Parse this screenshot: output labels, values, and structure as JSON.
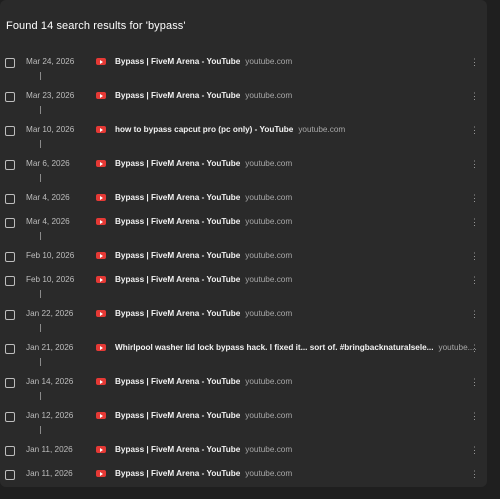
{
  "header": {
    "text": "Found 14 search results for 'bypass'"
  },
  "icons": {
    "favicon": "youtube-icon",
    "menu": "more-vert-icon"
  },
  "colors": {
    "background": "#1f1f1f",
    "panel": "#2a2a2a",
    "youtube_red": "#e53935"
  },
  "menu_glyph": "⋮",
  "results": [
    {
      "date": "Mar 24, 2026",
      "title": "Bypass | FiveM Arena - YouTube",
      "domain": "youtube.com"
    },
    {
      "date": "Mar 23, 2026",
      "title": "Bypass | FiveM Arena - YouTube",
      "domain": "youtube.com"
    },
    {
      "date": "Mar 10, 2026",
      "title": "how to bypass capcut pro (pc only) - YouTube",
      "domain": "youtube.com"
    },
    {
      "date": "Mar 6, 2026",
      "title": "Bypass | FiveM Arena - YouTube",
      "domain": "youtube.com"
    },
    {
      "date": "Mar 4, 2026",
      "title": "Bypass | FiveM Arena - YouTube",
      "domain": "youtube.com"
    },
    {
      "date": "Mar 4, 2026",
      "title": "Bypass | FiveM Arena - YouTube",
      "domain": "youtube.com"
    },
    {
      "date": "Feb 10, 2026",
      "title": "Bypass | FiveM Arena - YouTube",
      "domain": "youtube.com"
    },
    {
      "date": "Feb 10, 2026",
      "title": "Bypass | FiveM Arena - YouTube",
      "domain": "youtube.com"
    },
    {
      "date": "Jan 22, 2026",
      "title": "Bypass | FiveM Arena - YouTube",
      "domain": "youtube.com"
    },
    {
      "date": "Jan 21, 2026",
      "title": "Whirlpool washer lid lock bypass hack. I fixed it... sort of. #bringbacknaturalsele...",
      "domain": "youtube...."
    },
    {
      "date": "Jan 14, 2026",
      "title": "Bypass | FiveM Arena - YouTube",
      "domain": "youtube.com"
    },
    {
      "date": "Jan 12, 2026",
      "title": "Bypass | FiveM Arena - YouTube",
      "domain": "youtube.com"
    },
    {
      "date": "Jan 11, 2026",
      "title": "Bypass | FiveM Arena - YouTube",
      "domain": "youtube.com"
    },
    {
      "date": "Jan 11, 2026",
      "title": "Bypass | FiveM Arena - YouTube",
      "domain": "youtube.com"
    }
  ]
}
